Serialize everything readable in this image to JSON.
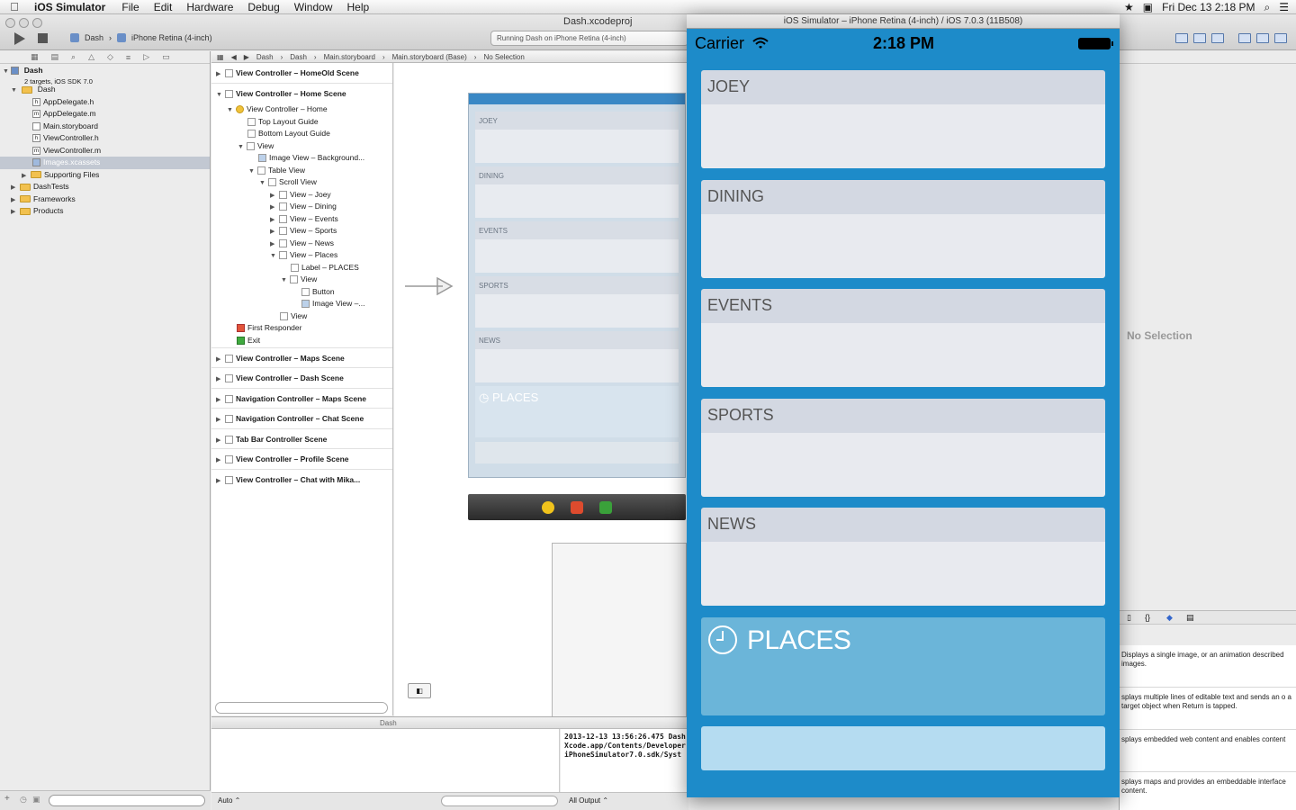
{
  "menubar": {
    "app_name": "iOS Simulator",
    "items": [
      "File",
      "Edit",
      "Hardware",
      "Debug",
      "Window",
      "Help"
    ],
    "datetime": "Fri Dec 13  2:18 PM"
  },
  "toolbar": {
    "scheme": "Dash",
    "destination": "iPhone Retina (4-inch)",
    "doc_title": "Dash.xcodeproj",
    "status": "Running Dash on iPhone Retina (4-inch)"
  },
  "jumpbar": {
    "items": [
      "Dash",
      "Dash",
      "Main.storyboard",
      "Main.storyboard (Base)",
      "No Selection"
    ]
  },
  "navigator": {
    "project": "Dash",
    "project_sub": "2 targets, iOS SDK 7.0",
    "folder": "Dash",
    "files": [
      "AppDelegate.h",
      "AppDelegate.m",
      "Main.storyboard",
      "ViewController.h",
      "ViewController.m",
      "Images.xcassets"
    ],
    "supporting": "Supporting Files",
    "groups": [
      "DashTests",
      "Frameworks",
      "Products"
    ]
  },
  "outline": {
    "scene_homeold": "View Controller – HomeOld Scene",
    "scene_home": "View Controller – Home Scene",
    "vc_home": "View Controller – Home",
    "top_guide": "Top Layout Guide",
    "bottom_guide": "Bottom Layout Guide",
    "view": "View",
    "image_bg": "Image View – Background...",
    "table_view": "Table View",
    "scroll_view": "Scroll View",
    "views": [
      "View – Joey",
      "View – Dining",
      "View – Events",
      "View – Sports",
      "View – News",
      "View – Places"
    ],
    "label_places": "Label – PLACES",
    "inner_view": "View",
    "button": "Button",
    "image_view": "Image View –...",
    "view2": "View",
    "first_responder": "First Responder",
    "exit": "Exit",
    "scenes": [
      "View Controller – Maps Scene",
      "View Controller – Dash Scene",
      "Navigation Controller – Maps Scene",
      "Navigation Controller – Chat Scene",
      "Tab Bar Controller Scene",
      "View Controller – Profile Scene",
      "View Controller – Chat with Mika..."
    ]
  },
  "storyboard": {
    "cells": [
      "JOEY",
      "DINING",
      "EVENTS",
      "SPORTS",
      "NEWS"
    ],
    "places": "PLACES"
  },
  "debug": {
    "target": "Dash",
    "console": "2013-12-13 13:56:26.475 Dash\nXcode.app/Contents/Developer\niPhoneSimulator7.0.sdk/Syst",
    "auto_label": "Auto ⌃",
    "output_label": "All Output ⌃"
  },
  "inspector": {
    "no_selection": "No Selection",
    "library": [
      "Displays a single image, or an animation described images.",
      "splays multiple lines of editable text and sends an o a target object when Return is tapped.",
      "splays embedded web content and enables content",
      "splays maps and provides an embeddable interface content."
    ]
  },
  "simulator": {
    "title": "iOS Simulator – iPhone Retina (4-inch) / iOS 7.0.3 (11B508)",
    "carrier": "Carrier",
    "time": "2:18 PM",
    "cells": [
      "JOEY",
      "DINING",
      "EVENTS",
      "SPORTS",
      "NEWS"
    ],
    "places": "PLACES"
  }
}
